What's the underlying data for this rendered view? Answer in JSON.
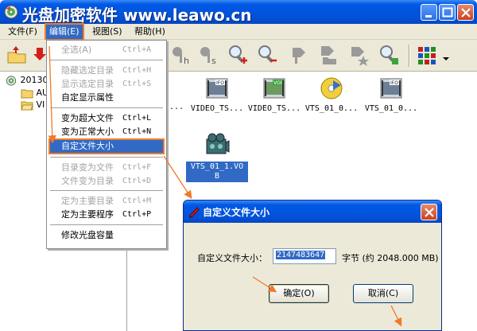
{
  "window": {
    "title": "光盘加密软件 www.leawo.cn",
    "colors": {
      "titlebar": "#0058e6",
      "highlight": "#316ac5",
      "annotation_arrow": "#f07a2a"
    }
  },
  "menubar": {
    "file": "文件(F)",
    "edit": "编辑(E)",
    "view": "视图(S)",
    "help": "帮助(H)"
  },
  "toolbar": {
    "icons": [
      "up-folder-icon",
      "bookmark-down-icon",
      "key-h-icon",
      "key-s-icon",
      "zoom-in-icon",
      "zoom-out-icon",
      "tag-icon",
      "folder-tag-icon",
      "star-tag-icon",
      "zoom-ok-icon",
      "grid-view-icon",
      "dropdown-arrow-icon"
    ]
  },
  "tree": {
    "root": "201306",
    "children": [
      "AU",
      "VI"
    ]
  },
  "files": [
    {
      "name": "VIDEO_TS...",
      "icon": "ifo-file-icon",
      "truncated_left": "..."
    },
    {
      "name": "VIDEO_TS...",
      "icon": "vob-file-icon"
    },
    {
      "name": "VTS_01_0...",
      "icon": "disc-file-icon"
    },
    {
      "name": "VTS_01_0...",
      "icon": "ifo-file-icon"
    },
    {
      "name": "VTS_01_1.VO",
      "name2": "B",
      "icon": "film-file-icon"
    }
  ],
  "edit_menu": {
    "items": [
      {
        "label": "全选(A)",
        "accel": "Ctrl+A",
        "disabled": true
      },
      {
        "label": "隐藏选定目录",
        "accel": "Ctrl+H",
        "disabled": true
      },
      {
        "label": "显示选定目录",
        "accel": "Ctrl+S",
        "disabled": true
      },
      {
        "label": "自定显示属性",
        "accel": "",
        "disabled": false
      },
      {
        "label": "变为超大文件",
        "accel": "Ctrl+L",
        "disabled": false
      },
      {
        "label": "变为正常大小",
        "accel": "Ctrl+N",
        "disabled": false
      },
      {
        "label": "自定文件大小",
        "accel": "",
        "disabled": false,
        "highlighted": true
      },
      {
        "label": "目录变为文件",
        "accel": "Ctrl+F",
        "disabled": true
      },
      {
        "label": "文件变为目录",
        "accel": "Ctrl+D",
        "disabled": true
      },
      {
        "label": "定为主要目录",
        "accel": "Ctrl+M",
        "disabled": true
      },
      {
        "label": "定为主要程序",
        "accel": "Ctrl+P",
        "disabled": false
      },
      {
        "label": "修改光盘容量",
        "accel": "",
        "disabled": false
      }
    ]
  },
  "dialog": {
    "title": "自定义文件大小",
    "field_label": "自定义文件大小：",
    "field_value": "2147483647",
    "bytes_text": "字节 (约 2048.000 MB)",
    "ok_label": "确定(O)",
    "cancel_label": "取消(C)"
  }
}
